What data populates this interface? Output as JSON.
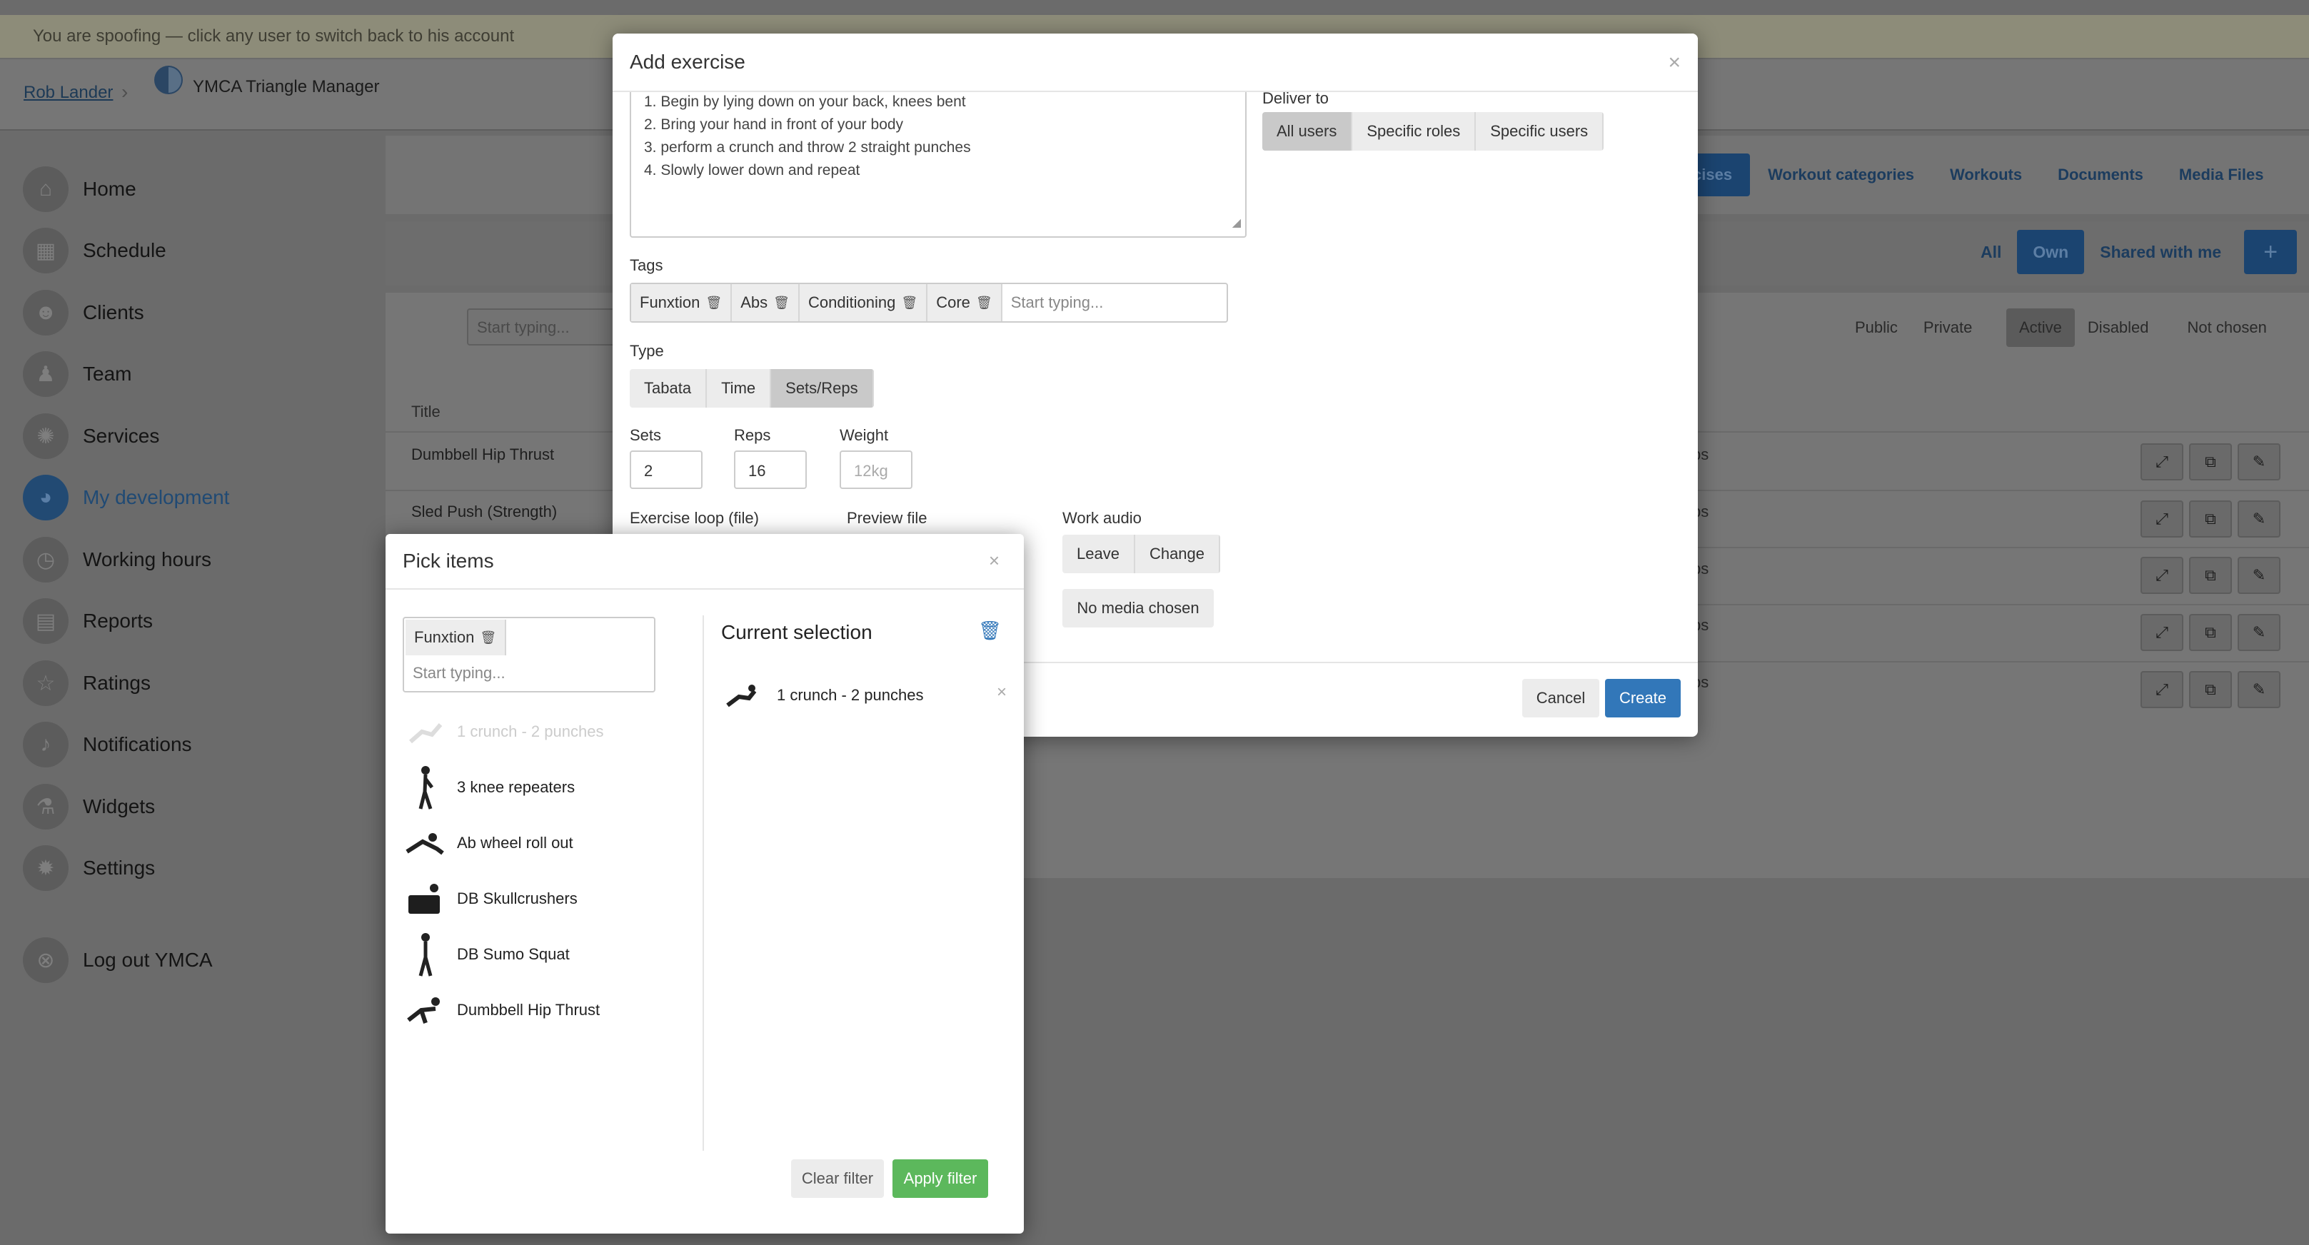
{
  "spoof_banner": "You are spoofing — click any user to switch back to his account",
  "breadcrumb": {
    "user": "Rob Lander",
    "org": "YMCA Triangle Manager"
  },
  "sidebar": {
    "items": [
      {
        "label": "Home",
        "icon": "home-icon"
      },
      {
        "label": "Schedule",
        "icon": "calendar-icon"
      },
      {
        "label": "Clients",
        "icon": "clients-icon"
      },
      {
        "label": "Team",
        "icon": "team-icon"
      },
      {
        "label": "Services",
        "icon": "gear-icon"
      },
      {
        "label": "My development",
        "icon": "dashboard-icon"
      },
      {
        "label": "Working hours",
        "icon": "clock-icon"
      },
      {
        "label": "Reports",
        "icon": "reports-icon"
      },
      {
        "label": "Ratings",
        "icon": "star-icon"
      },
      {
        "label": "Notifications",
        "icon": "bell-icon"
      },
      {
        "label": "Widgets",
        "icon": "flask-icon"
      },
      {
        "label": "Settings",
        "icon": "gear-icon"
      }
    ],
    "logout": "Log out YMCA",
    "active": "My development"
  },
  "main": {
    "tabs": [
      "cises",
      "Workout categories",
      "Workouts",
      "Documents",
      "Media Files"
    ],
    "ownership": [
      "All",
      "Own",
      "Shared with me"
    ],
    "ownership_selected": "Own",
    "add_label": "+",
    "search_placeholder": "Start typing...",
    "visibility": [
      "Public",
      "Private"
    ],
    "status": [
      "Active",
      "Disabled",
      "Not chosen"
    ],
    "status_selected": "Active",
    "table_header_title": "Title",
    "rows": [
      {
        "title": "Dumbbell Hip Thrust",
        "tail": "ps"
      },
      {
        "title": "Sled Push (Strength)",
        "tail": "ps"
      },
      {
        "title": "",
        "tail": "ps"
      },
      {
        "title": "",
        "tail": "ps"
      },
      {
        "title": "",
        "tail": "ps"
      }
    ]
  },
  "add_exercise": {
    "title": "Add exercise",
    "description_lines": [
      "1. Begin by lying down on your back, knees bent",
      "2. Bring your hand in front of your body",
      "3. perform a crunch and throw 2 straight punches",
      "4. Slowly lower down and repeat"
    ],
    "deliver_to_label": "Deliver to",
    "deliver_to": [
      "All users",
      "Specific roles",
      "Specific users"
    ],
    "deliver_to_selected": "All users",
    "tags_label": "Tags",
    "tags": [
      "Funxtion",
      "Abs",
      "Conditioning",
      "Core"
    ],
    "tags_placeholder": "Start typing...",
    "type_label": "Type",
    "types": [
      "Tabata",
      "Time",
      "Sets/Reps"
    ],
    "type_selected": "Sets/Reps",
    "sets_label": "Sets",
    "sets_value": "2",
    "reps_label": "Reps",
    "reps_value": "16",
    "weight_label": "Weight",
    "weight_placeholder": "12kg",
    "exercise_loop_label": "Exercise loop (file)",
    "preview_file_label": "Preview file",
    "work_audio_label": "Work audio",
    "audio_buttons": [
      "Leave",
      "Change"
    ],
    "no_media": "No media chosen",
    "cancel": "Cancel",
    "create": "Create"
  },
  "pick_items": {
    "title": "Pick items",
    "filter_tag": "Funxtion",
    "filter_placeholder": "Start typing...",
    "items": [
      {
        "name": "1 crunch - 2 punches",
        "disabled": true
      },
      {
        "name": "3 knee repeaters",
        "disabled": false
      },
      {
        "name": "Ab wheel roll out",
        "disabled": false
      },
      {
        "name": "DB Skullcrushers",
        "disabled": false
      },
      {
        "name": "DB Sumo Squat",
        "disabled": false
      },
      {
        "name": "Dumbbell Hip Thrust",
        "disabled": false
      }
    ],
    "current_selection_label": "Current selection",
    "selected": [
      "1 crunch - 2 punches"
    ],
    "clear_filter": "Clear filter",
    "apply_filter": "Apply filter"
  },
  "colors": {
    "primary": "#3277b9",
    "success": "#5cb85c",
    "overlay": "#6b6b6b"
  }
}
